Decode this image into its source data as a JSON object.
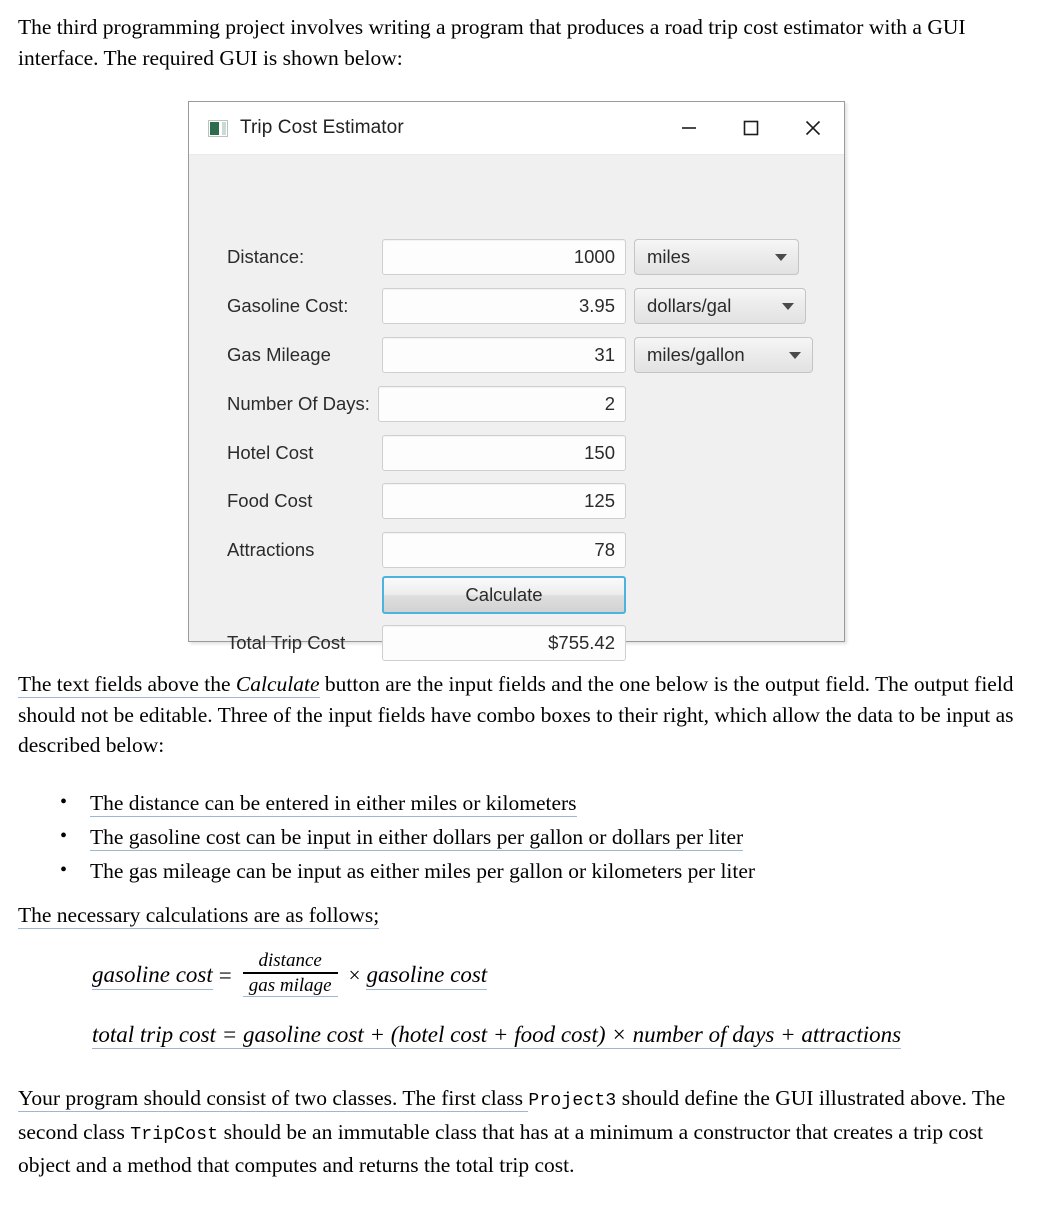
{
  "document": {
    "intro_part1": "The third programming project involves writing a program that produces a road trip cost estimator with a GUI interface. The required GUI is shown below:",
    "mid_part1": "The text fields above the ",
    "mid_italic": "Calculate",
    "mid_part2": " button are the input fields and the one below is the output field. The output field should not be editable. Three of the input fields have combo boxes to their right, which allow the data to be input as described below:",
    "bullets": [
      "The distance can be entered in either miles or kilometers",
      "The gasoline cost can be input in either dollars per gallon or dollars per liter",
      "The gas mileage can be input as either miles per gallon or kilometers per liter"
    ],
    "calcs_heading": "The necessary calculations are as follows;",
    "final_part1": "Your program should consist of two classes. The first class ",
    "final_class1": "Project3",
    "final_part2": " should define the GUI illustrated above. The second class ",
    "final_class2": "TripCost",
    "final_part3": " should be an immutable class that has at a minimum a constructor that creates a trip cost object and a method that computes and returns the total trip cost."
  },
  "formulas": {
    "one": {
      "lhs": "gasoline cost",
      "equals": "=",
      "numerator": "distance",
      "denominator": "gas milage",
      "times": "×",
      "rhs": "gasoline cost"
    },
    "two": {
      "text": "total trip cost = gasoline cost + (hotel cost + food cost) × number of days + attractions"
    }
  },
  "gui": {
    "title": "Trip Cost Estimator",
    "icon": "app-icon",
    "controls": {
      "minimize": "minimize",
      "maximize": "maximize",
      "close": "close"
    },
    "rows": [
      {
        "label": "Distance:",
        "value": "1000",
        "unit": "miles"
      },
      {
        "label": "Gasoline Cost:",
        "value": "3.95",
        "unit": "dollars/gal"
      },
      {
        "label": "Gas Mileage",
        "value": "31",
        "unit": "miles/gallon"
      },
      {
        "label": "Number Of Days:",
        "value": "2",
        "unit": null
      },
      {
        "label": "Hotel Cost",
        "value": "150",
        "unit": null
      },
      {
        "label": "Food Cost",
        "value": "125",
        "unit": null
      },
      {
        "label": "Attractions",
        "value": "78",
        "unit": null
      }
    ],
    "calculate_button": "Calculate",
    "output_row": {
      "label": "Total Trip Cost",
      "value": "$755.42"
    },
    "accent_color": "#4cb3e0"
  }
}
